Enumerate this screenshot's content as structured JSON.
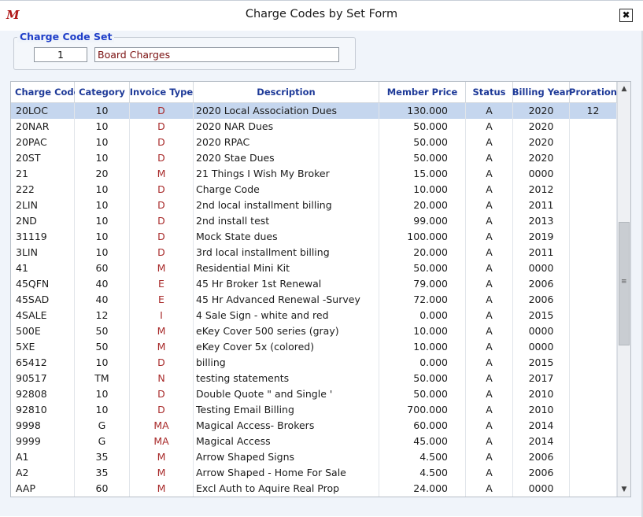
{
  "window": {
    "title": "Charge Codes by Set Form",
    "close_label": "✖",
    "logo": "M"
  },
  "charge_code_set": {
    "legend": "Charge Code Set",
    "number": "1",
    "name": "Board Charges"
  },
  "grid": {
    "columns": [
      "Charge Code",
      "Category",
      "Invoice Type",
      "Description",
      "Member Price",
      "Status",
      "Billing Year",
      "Proration"
    ],
    "selected_row": 0,
    "rows": [
      [
        "20LOC",
        "10",
        "D",
        "2020 Local Association Dues",
        "130.000",
        "A",
        "2020",
        "12"
      ],
      [
        "20NAR",
        "10",
        "D",
        "2020 NAR Dues",
        "50.000",
        "A",
        "2020",
        ""
      ],
      [
        "20PAC",
        "10",
        "D",
        "2020 RPAC",
        "50.000",
        "A",
        "2020",
        ""
      ],
      [
        "20ST",
        "10",
        "D",
        "2020 Stae Dues",
        "50.000",
        "A",
        "2020",
        ""
      ],
      [
        "21",
        "20",
        "M",
        "21 Things I Wish My Broker",
        "15.000",
        "A",
        "0000",
        ""
      ],
      [
        "222",
        "10",
        "D",
        "Charge Code",
        "10.000",
        "A",
        "2012",
        ""
      ],
      [
        "2LIN",
        "10",
        "D",
        "2nd local installment billing",
        "20.000",
        "A",
        "2011",
        ""
      ],
      [
        "2ND",
        "10",
        "D",
        "2nd install test",
        "99.000",
        "A",
        "2013",
        ""
      ],
      [
        "31119",
        "10",
        "D",
        "Mock State dues",
        "100.000",
        "A",
        "2019",
        ""
      ],
      [
        "3LIN",
        "10",
        "D",
        "3rd local installment billing",
        "20.000",
        "A",
        "2011",
        ""
      ],
      [
        "41",
        "60",
        "M",
        "Residential Mini Kit",
        "50.000",
        "A",
        "0000",
        ""
      ],
      [
        "45QFN",
        "40",
        "E",
        "45 Hr Broker 1st Renewal",
        "79.000",
        "A",
        "2006",
        ""
      ],
      [
        "45SAD",
        "40",
        "E",
        "45 Hr Advanced Renewal -Survey",
        "72.000",
        "A",
        "2006",
        ""
      ],
      [
        "4SALE",
        "12",
        "I",
        "4 Sale Sign - white and red",
        "0.000",
        "A",
        "2015",
        ""
      ],
      [
        "500E",
        "50",
        "M",
        "eKey Cover 500 series (gray)",
        "10.000",
        "A",
        "0000",
        ""
      ],
      [
        "5XE",
        "50",
        "M",
        "eKey Cover 5x (colored)",
        "10.000",
        "A",
        "0000",
        ""
      ],
      [
        "65412",
        "10",
        "D",
        "billing",
        "0.000",
        "A",
        "2015",
        ""
      ],
      [
        "90517",
        "TM",
        "N",
        "testing statements",
        "50.000",
        "A",
        "2017",
        ""
      ],
      [
        "92808",
        "10",
        "D",
        "Double Quote \" and Single '",
        "50.000",
        "A",
        "2010",
        ""
      ],
      [
        "92810",
        "10",
        "D",
        "Testing Email Billing",
        "700.000",
        "A",
        "2010",
        ""
      ],
      [
        "9998",
        "G",
        "MA",
        "Magical Access- Brokers",
        "60.000",
        "A",
        "2014",
        ""
      ],
      [
        "9999",
        "G",
        "MA",
        "Magical Access",
        "45.000",
        "A",
        "2014",
        ""
      ],
      [
        "A1",
        "35",
        "M",
        "Arrow Shaped Signs",
        "4.500",
        "A",
        "2006",
        ""
      ],
      [
        "A2",
        "35",
        "M",
        "Arrow Shaped - Home For Sale",
        "4.500",
        "A",
        "2006",
        ""
      ],
      [
        "AAP",
        "60",
        "M",
        "Excl Auth to Aquire Real Prop",
        "24.000",
        "A",
        "0000",
        ""
      ]
    ]
  },
  "scrollbar": {
    "up": "▲",
    "down": "▼",
    "grip": "≡"
  },
  "colors": {
    "header_text": "#1e3a98",
    "legend_text": "#1e3ec8",
    "invoice_type_text": "#a82a2a",
    "selected_row": "#c5d6ee",
    "set_name_text": "#7a1010"
  }
}
